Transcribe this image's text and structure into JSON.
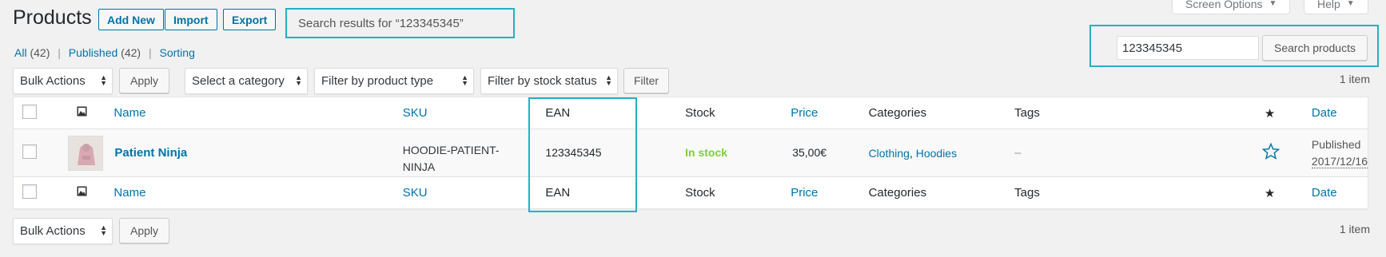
{
  "header": {
    "title": "Products",
    "add_new": "Add New",
    "import": "Import",
    "export": "Export",
    "search_summary": "Search results for “123345345”",
    "screen_options": "Screen Options",
    "help": "Help"
  },
  "views": [
    {
      "label": "All",
      "count": "(42)"
    },
    {
      "label": "Published",
      "count": "(42)"
    },
    {
      "label": "Sorting"
    }
  ],
  "search": {
    "value": "123345345",
    "button": "Search products"
  },
  "filters": {
    "bulk_actions": "Bulk Actions",
    "apply": "Apply",
    "category": "Select a category",
    "product_type": "Filter by product type",
    "stock_status": "Filter by stock status",
    "filter_button": "Filter"
  },
  "items_count": "1 item",
  "columns": {
    "name": "Name",
    "sku": "SKU",
    "ean": "EAN",
    "stock": "Stock",
    "price": "Price",
    "categories": "Categories",
    "tags": "Tags",
    "date": "Date"
  },
  "rows": [
    {
      "name": "Patient Ninja",
      "sku_line1": "HOODIE-PATIENT-",
      "sku_line2": "NINJA",
      "ean": "123345345",
      "stock": "In stock",
      "price": "35,00€",
      "category1": "Clothing",
      "category2": "Hoodies",
      "tags": "–",
      "status": "Published",
      "date": "2017/12/16"
    }
  ],
  "colors": {
    "link": "#0073aa",
    "in_stock": "#7ad03a",
    "highlight_frame": "#25b0c5"
  }
}
